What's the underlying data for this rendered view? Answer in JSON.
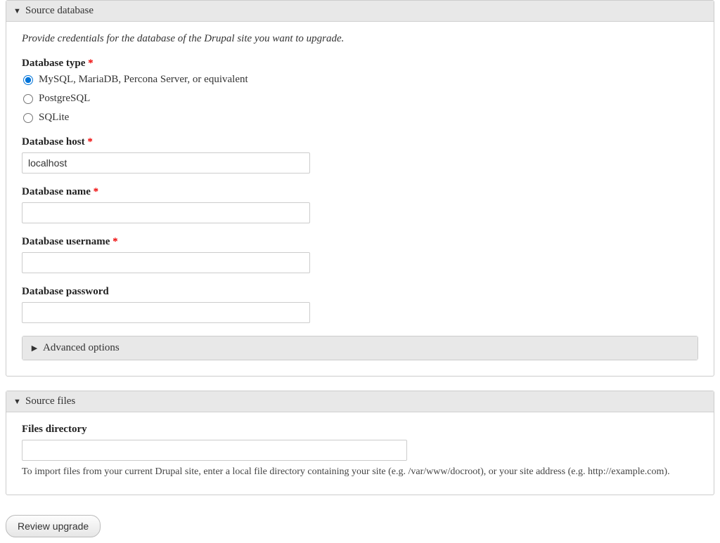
{
  "source_db": {
    "header": "Source database",
    "description": "Provide credentials for the database of the Drupal site you want to upgrade.",
    "db_type_label": "Database type",
    "required_mark": "*",
    "options": {
      "mysql": "MySQL, MariaDB, Percona Server, or equivalent",
      "pgsql": "PostgreSQL",
      "sqlite": "SQLite"
    },
    "host_label": "Database host",
    "host_value": "localhost",
    "name_label": "Database name",
    "name_value": "",
    "user_label": "Database username",
    "user_value": "",
    "pass_label": "Database password",
    "pass_value": "",
    "advanced_label": "Advanced options"
  },
  "source_files": {
    "header": "Source files",
    "dir_label": "Files directory",
    "dir_value": "",
    "help": "To import files from your current Drupal site, enter a local file directory containing your site (e.g. /var/www/docroot), or your site address (e.g. http://example.com)."
  },
  "actions": {
    "review": "Review upgrade"
  }
}
